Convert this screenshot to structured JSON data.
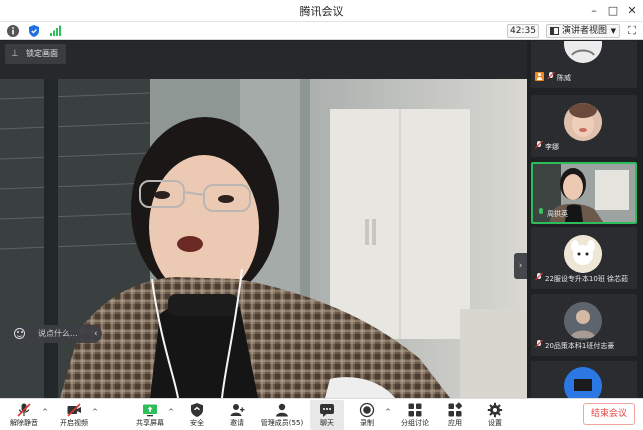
{
  "window": {
    "title": "腾讯会议",
    "minimize": "–",
    "maximize": "□",
    "close": "✕"
  },
  "info_bar": {
    "timer": "42:35",
    "view_mode": "演讲者视图",
    "fullscreen_glyph": "⛶"
  },
  "main": {
    "lock_label": "锁定画面",
    "pin_glyph": "⊥",
    "chat_placeholder": "说点什么...",
    "chat_chevron": "‹",
    "collapse_chevron": "›"
  },
  "participants": [
    {
      "name": "陈威",
      "muted": true,
      "has_avatar_badge": true
    },
    {
      "name": "李娜",
      "muted": true
    },
    {
      "name": "周拱英",
      "muted": false,
      "active": true
    },
    {
      "name": "22服设专升本10班 徐芯茹",
      "muted": true
    },
    {
      "name": "20品策本科1班付志豪",
      "muted": true
    },
    {
      "name": "",
      "muted": true
    }
  ],
  "toolbar": {
    "items": [
      {
        "key": "unmute",
        "label": "解除静音",
        "icon": "mic-muted-icon"
      },
      {
        "key": "video",
        "label": "开启视频",
        "icon": "video-off-icon"
      },
      {
        "key": "share",
        "label": "共享屏幕",
        "icon": "share-screen-icon"
      },
      {
        "key": "security",
        "label": "安全",
        "icon": "shield-icon"
      },
      {
        "key": "invite",
        "label": "邀请",
        "icon": "invite-user-icon"
      },
      {
        "key": "members",
        "label": "管理成员(55)",
        "icon": "members-icon"
      },
      {
        "key": "chat",
        "label": "聊天",
        "icon": "chat-icon"
      },
      {
        "key": "record",
        "label": "录制",
        "icon": "record-icon"
      },
      {
        "key": "breakout",
        "label": "分组讨论",
        "icon": "breakout-icon"
      },
      {
        "key": "apps",
        "label": "应用",
        "icon": "apps-icon"
      },
      {
        "key": "settings",
        "label": "设置",
        "icon": "gear-icon"
      }
    ],
    "end_meeting": "结束会议"
  },
  "colors": {
    "accent_green": "#2ebd5b",
    "end_red": "#e54545",
    "mute_red": "#e0362f",
    "shield_blue": "#1e6fe0"
  }
}
